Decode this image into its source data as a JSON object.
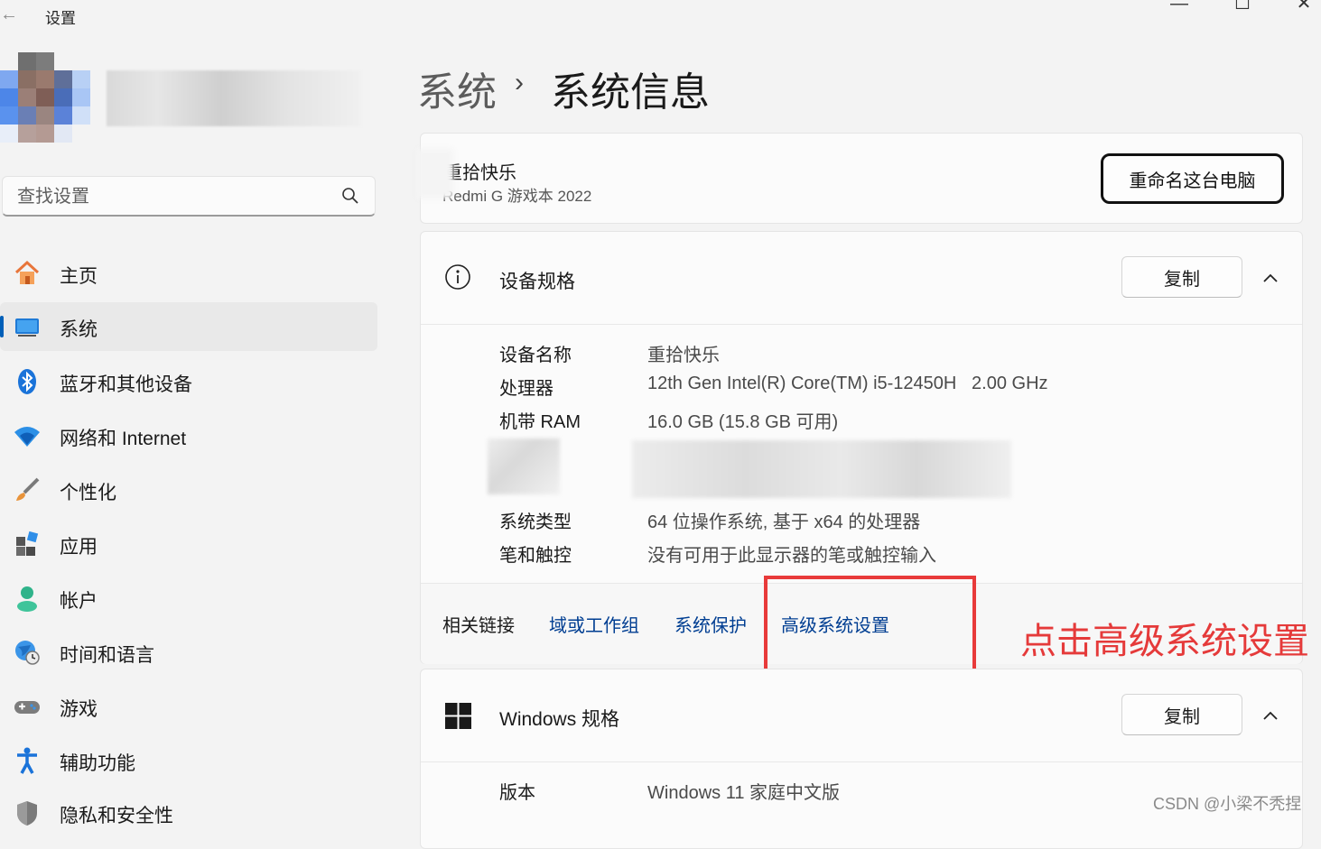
{
  "window": {
    "title": "设置",
    "controls": [
      "—",
      "☐",
      "✕"
    ]
  },
  "search": {
    "placeholder": "查找设置"
  },
  "sidebar": {
    "items": [
      {
        "label": "主页",
        "icon": "home-icon"
      },
      {
        "label": "系统",
        "icon": "system-icon",
        "selected": true
      },
      {
        "label": "蓝牙和其他设备",
        "icon": "bluetooth-icon"
      },
      {
        "label": "网络和 Internet",
        "icon": "wifi-icon"
      },
      {
        "label": "个性化",
        "icon": "brush-icon"
      },
      {
        "label": "应用",
        "icon": "apps-icon"
      },
      {
        "label": "帐户",
        "icon": "account-icon"
      },
      {
        "label": "时间和语言",
        "icon": "globe-clock-icon"
      },
      {
        "label": "游戏",
        "icon": "gamepad-icon"
      },
      {
        "label": "辅助功能",
        "icon": "accessibility-icon"
      },
      {
        "label": "隐私和安全性",
        "icon": "shield-icon"
      }
    ]
  },
  "breadcrumb": {
    "parent": "系统",
    "separator": "›",
    "current": "系统信息"
  },
  "pc": {
    "name": "重拾快乐",
    "model": "Redmi G 游戏本 2022",
    "rename_label": "重命名这台电脑"
  },
  "device_specs": {
    "title": "设备规格",
    "copy_label": "复制",
    "rows": [
      {
        "label": "设备名称",
        "value": "重拾快乐"
      },
      {
        "label": "处理器",
        "value": "12th Gen Intel(R) Core(TM) i5-12450H   2.00 GHz"
      },
      {
        "label": "机带 RAM",
        "value": "16.0 GB (15.8 GB 可用)"
      },
      {
        "label": "系统类型",
        "value": "64 位操作系统, 基于 x64 的处理器"
      },
      {
        "label": "笔和触控",
        "value": "没有可用于此显示器的笔或触控输入"
      }
    ]
  },
  "related_links": {
    "label": "相关链接",
    "links": [
      "域或工作组",
      "系统保护",
      "高级系统设置"
    ]
  },
  "annotation": {
    "text": "点击高级系统设置",
    "color": "#e53a3a"
  },
  "windows_specs": {
    "title": "Windows 规格",
    "copy_label": "复制",
    "rows": [
      {
        "label": "版本",
        "value": "Windows 11 家庭中文版"
      }
    ]
  },
  "watermark": "CSDN @小梁不秃捏",
  "colors": {
    "accent": "#005fb8",
    "link": "#003e92",
    "highlight": "#e83a3a"
  }
}
